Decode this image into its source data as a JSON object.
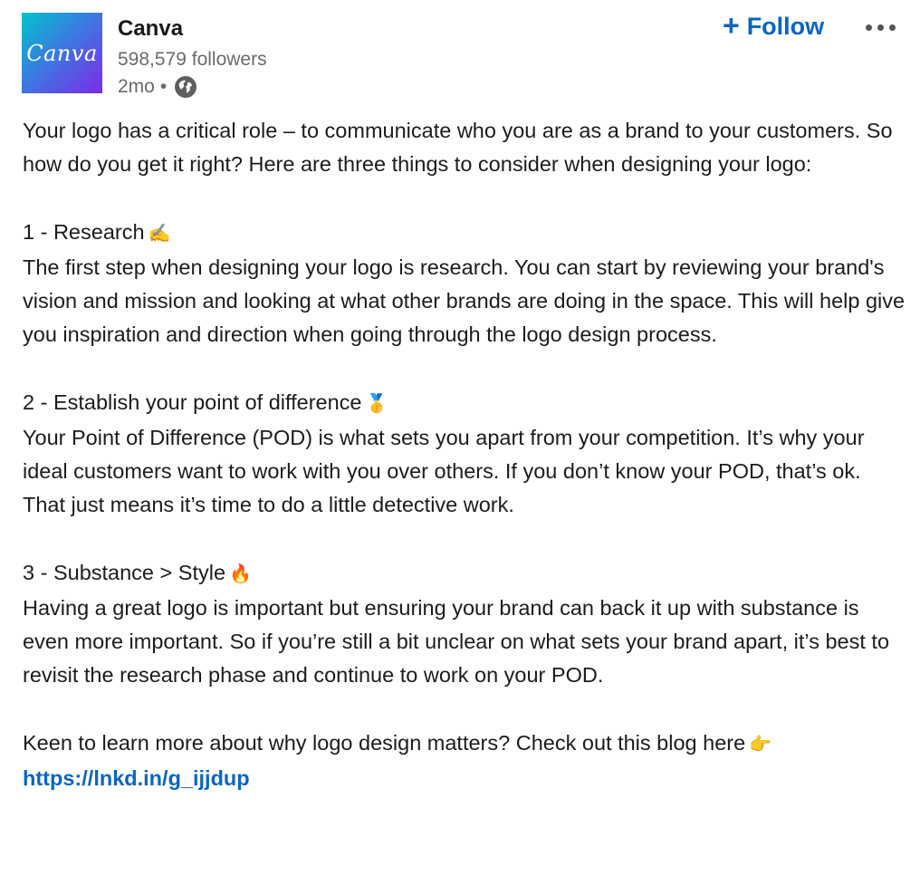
{
  "company": {
    "logo_text": "Canva",
    "name": "Canva",
    "followers": "598,579 followers",
    "time": "2mo",
    "separator": "•"
  },
  "actions": {
    "follow_plus": "+",
    "follow_label": "Follow"
  },
  "icons": {
    "visibility": "globe-icon",
    "more": "more-options-icon"
  },
  "post": {
    "intro": "Your logo has a critical role – to communicate who you are as a brand to your customers. So how do you get it right? Here are three things to consider when designing your logo:",
    "section1_heading": "1 - Research",
    "section1_emoji": "✍️",
    "section1_body": "The first step when designing your logo is research. You can start by reviewing your brand's vision and mission and looking at what other brands are doing in the space. This will help give you inspiration and direction when going through the logo design process.",
    "section2_heading": "2 - Establish your point of difference",
    "section2_emoji": "🥇",
    "section2_body": "Your Point of Difference (POD) is what sets you apart from your competition. It’s why your ideal customers want to work with you over others. If you don’t know your POD, that’s ok. That just means it’s time to do a little detective work.",
    "section3_heading": "3 - Substance > Style",
    "section3_emoji": "🔥",
    "section3_body": "Having a great logo is important but ensuring your brand can back it up with substance is even more important. So if you’re still a bit unclear on what sets your brand apart, it’s best to revisit the research phase and continue to work on your POD.",
    "cta": "Keen to learn more about why logo design matters? Check out this blog here",
    "cta_emoji": "👉",
    "link": "https://lnkd.in/g_ijjdup"
  },
  "colors": {
    "link_blue": "#0a66c2",
    "muted_text": "#6b6b6b",
    "logo_gradient_start": "#00c4cc",
    "logo_gradient_end": "#7d2ae8"
  }
}
